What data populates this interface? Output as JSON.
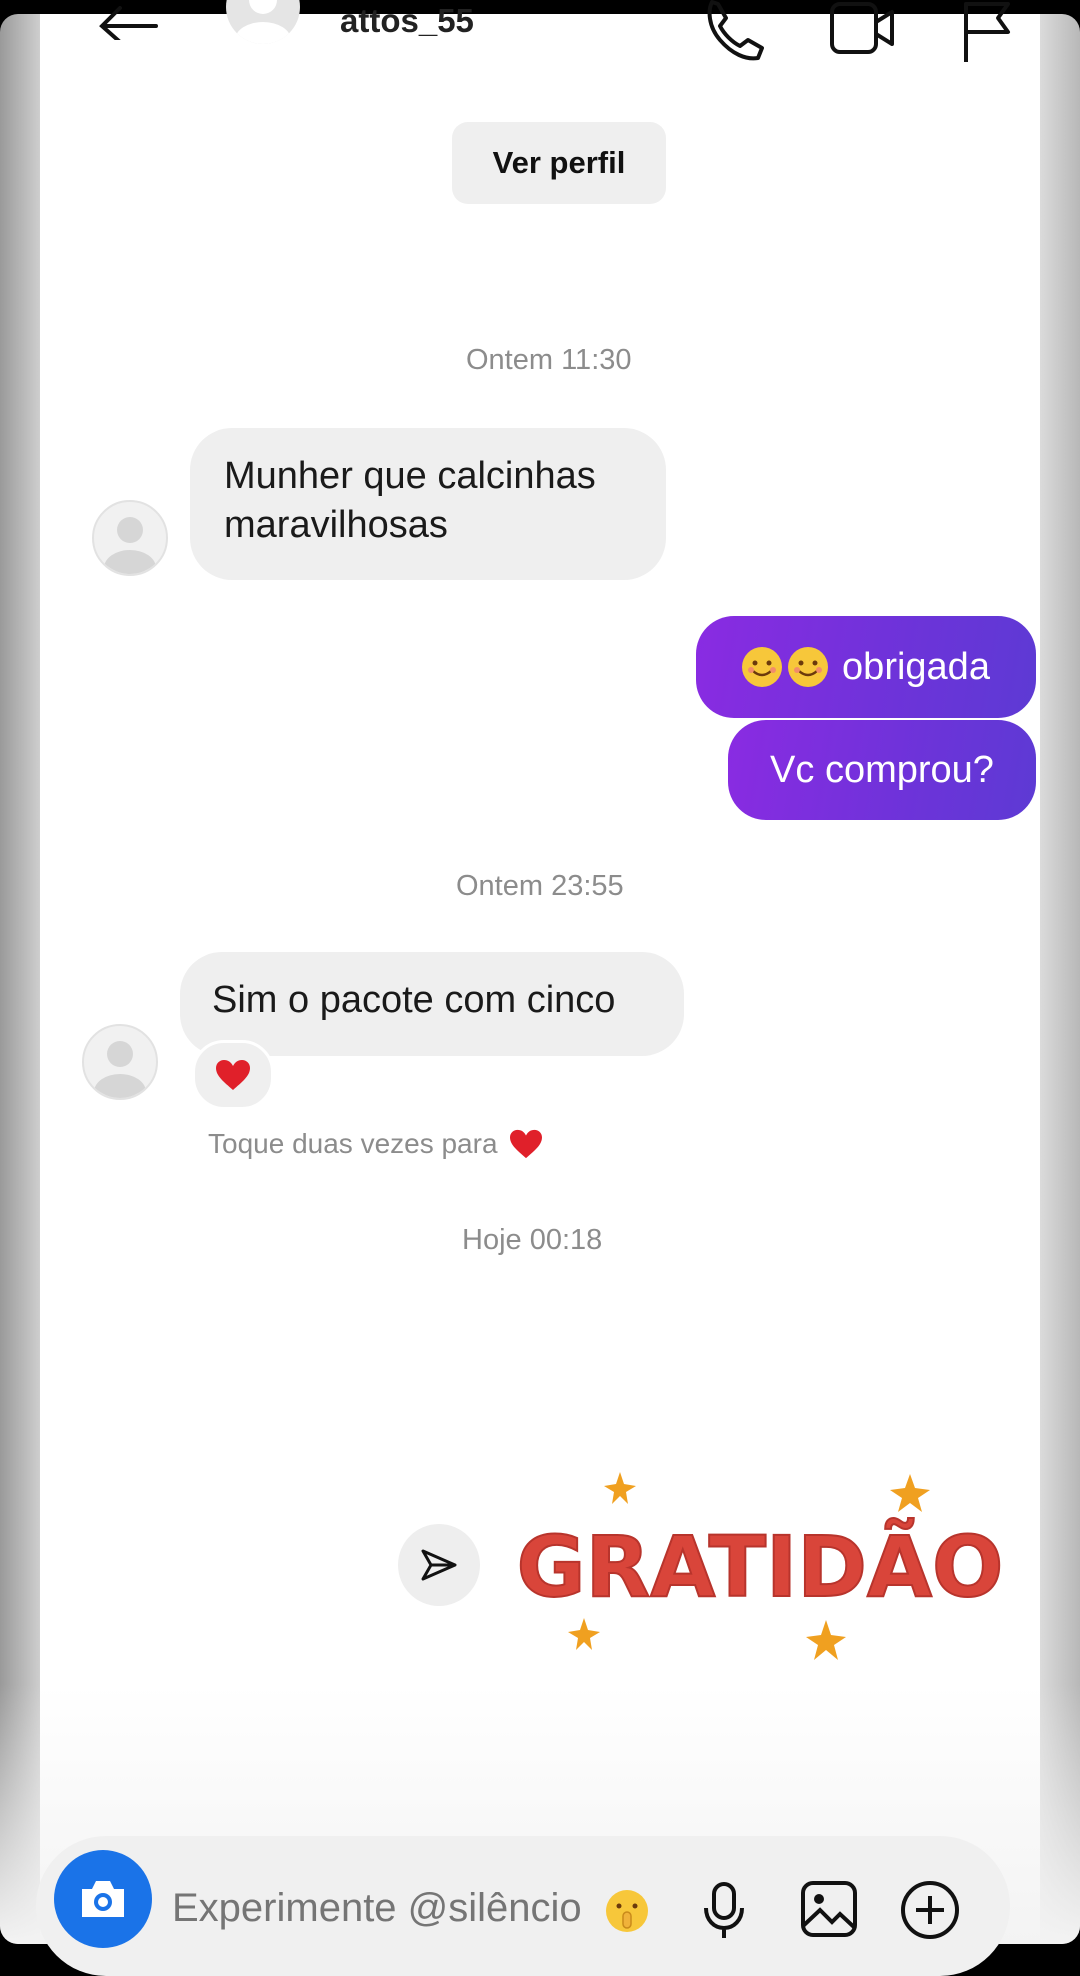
{
  "header": {
    "username": "attos_55"
  },
  "view_profile_label": "Ver perfil",
  "timestamps": [
    "Ontem 11:30",
    "Ontem 23:55",
    "Hoje 00:18"
  ],
  "messages": {
    "m1": "Munher que calcinhas maravilhosas",
    "m2": "obrigada",
    "m2_emojis": "smiling-face-icon x2",
    "m3": "Vc comprou?",
    "m4": "Sim o pacote com cinco"
  },
  "reaction": "red-heart",
  "double_tap_hint": "Toque duas vezes para",
  "sticker_text": "GRATIDÃO",
  "composer": {
    "placeholder": "Experimente @silêncio"
  },
  "colors": {
    "outgoing_bubble": "#7a33dc",
    "incoming_bubble": "#efefef",
    "camera_button": "#1a73e8",
    "sticker_red": "#d9453a",
    "sticker_star": "#f0a020"
  }
}
